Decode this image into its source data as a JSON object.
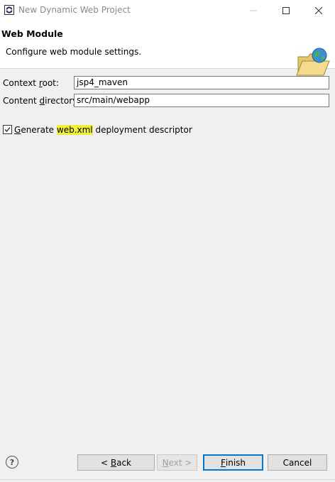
{
  "window": {
    "title": "New Dynamic Web Project"
  },
  "header": {
    "title": "Web Module",
    "description": "Configure web module settings."
  },
  "form": {
    "context_root": {
      "label_prefix": "Context ",
      "label_mnemonic": "r",
      "label_suffix": "oot:",
      "value": "jsp4_maven"
    },
    "content_directory": {
      "label_prefix": "Content ",
      "label_mnemonic": "d",
      "label_suffix": "irectory:",
      "value": "src/main/webapp"
    },
    "generate_descriptor": {
      "checked": true,
      "label_mnemonic": "G",
      "label_part1": "enerate ",
      "label_highlight": "web.xml",
      "label_part2": " deployment descriptor"
    }
  },
  "footer": {
    "help_symbol": "?",
    "back": {
      "prefix": "< ",
      "mnemonic": "B",
      "suffix": "ack"
    },
    "next": {
      "mnemonic": "N",
      "suffix": "ext >"
    },
    "finish": {
      "mnemonic": "F",
      "suffix": "inish"
    },
    "cancel": "Cancel"
  },
  "icons": {
    "app": "eclipse-icon",
    "banner": "folder-globe-icon"
  },
  "colors": {
    "highlight": "#f0ef3a",
    "default_button_border": "#0078d7"
  }
}
